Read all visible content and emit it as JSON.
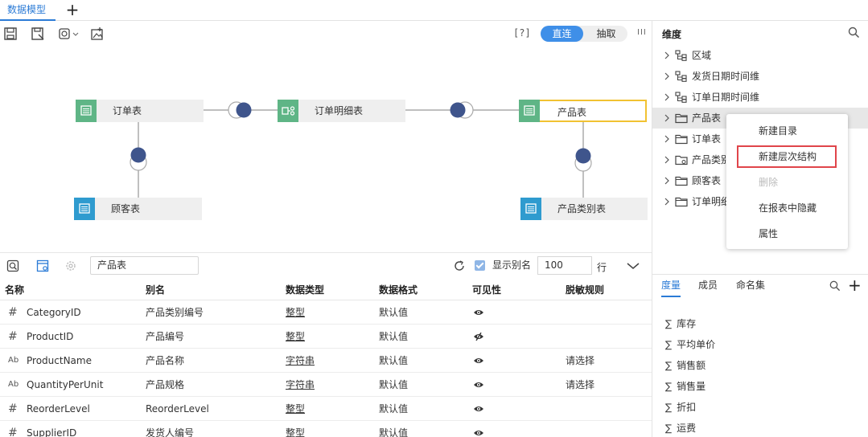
{
  "tab": {
    "label": "数据模型",
    "add": "+"
  },
  "toolbar": {
    "help": "[?]",
    "mode_on": "直连",
    "mode_off": "抽取",
    "collapse": "III"
  },
  "nodes": {
    "orders": "订单表",
    "order_details": "订单明细表",
    "products": "产品表",
    "customers": "顾客表",
    "categories": "产品类别表"
  },
  "field_toolbar": {
    "search_value": "产品表",
    "show_alias_label": "显示别名",
    "show_alias_checked": true,
    "rows_value": "100",
    "rows_unit": "行"
  },
  "table": {
    "headers": [
      "名称",
      "别名",
      "数据类型",
      "数据格式",
      "可见性",
      "脱敏规则"
    ],
    "rows": [
      {
        "type": "#",
        "name": "CategoryID",
        "alias": "产品类别编号",
        "dtype": "整型",
        "format": "默认值",
        "visible": "eye",
        "mask": ""
      },
      {
        "type": "#",
        "name": "ProductID",
        "alias": "产品编号",
        "dtype": "整型",
        "format": "默认值",
        "visible": "eye-off",
        "mask": ""
      },
      {
        "type": "Ab",
        "name": "ProductName",
        "alias": "产品名称",
        "dtype": "字符串",
        "format": "默认值",
        "visible": "eye",
        "mask": "请选择"
      },
      {
        "type": "Ab",
        "name": "QuantityPerUnit",
        "alias": "产品规格",
        "dtype": "字符串",
        "format": "默认值",
        "visible": "eye",
        "mask": "请选择"
      },
      {
        "type": "#",
        "name": "ReorderLevel",
        "alias": "ReorderLevel",
        "dtype": "整型",
        "format": "默认值",
        "visible": "eye",
        "mask": ""
      },
      {
        "type": "#",
        "name": "SupplierID",
        "alias": "发货人编号",
        "dtype": "整型",
        "format": "默认值",
        "visible": "eye",
        "mask": ""
      }
    ]
  },
  "dimensions": {
    "title": "维度",
    "items": [
      {
        "label": "区域",
        "icon": "hierarchy-icon"
      },
      {
        "label": "发货日期时间维",
        "icon": "hierarchy-icon"
      },
      {
        "label": "订单日期时间维",
        "icon": "hierarchy-icon"
      },
      {
        "label": "产品表",
        "icon": "folder-icon"
      },
      {
        "label": "订单表",
        "icon": "folder-icon"
      },
      {
        "label": "产品类别",
        "icon": "folder-link-icon"
      },
      {
        "label": "顾客表",
        "icon": "folder-icon"
      },
      {
        "label": "订单明细",
        "icon": "folder-icon"
      }
    ]
  },
  "measure_tabs": [
    "度量",
    "成员",
    "命名集"
  ],
  "measures": [
    "库存",
    "平均单价",
    "销售额",
    "销售量",
    "折扣",
    "运费"
  ],
  "context_menu": {
    "items": [
      "新建目录",
      "新建层次结构",
      "删除",
      "在报表中隐藏",
      "属性"
    ]
  }
}
